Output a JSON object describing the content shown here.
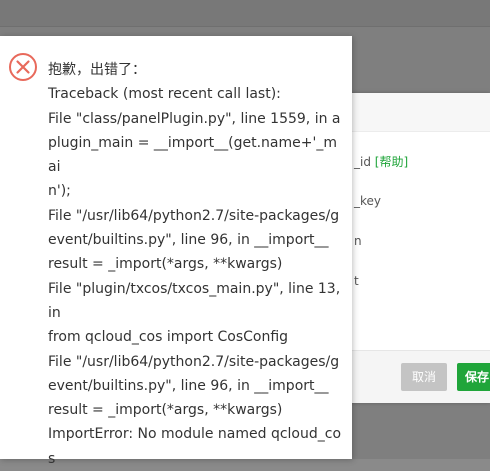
{
  "background_dialog": {
    "fields": [
      {
        "text": "_id ",
        "link": "[帮助]"
      },
      {
        "text": "_key",
        "link": ""
      },
      {
        "text": "n",
        "link": ""
      },
      {
        "text": "t",
        "link": ""
      }
    ],
    "cancel_label": "取消",
    "save_label": "保存"
  },
  "error_popup": {
    "lines": [
      "抱歉，出错了：",
      "Traceback (most recent call last):",
      "File \"class/panelPlugin.py\", line 1559, in a",
      "plugin_main = __import__(get.name+'_mai",
      "n');",
      "File \"/usr/lib64/python2.7/site-packages/g",
      "event/builtins.py\", line 96, in __import__",
      "result = _import(*args, **kwargs)",
      "File \"plugin/txcos/txcos_main.py\", line 13,",
      "in",
      "from qcloud_cos import CosConfig",
      "File \"/usr/lib64/python2.7/site-packages/g",
      "event/builtins.py\", line 96, in __import__",
      "result = _import(*args, **kwargs)",
      "ImportError: No module named qcloud_co",
      "s"
    ],
    "icon": "error-x-circle-icon",
    "icon_color": "#e8695b"
  },
  "colors": {
    "accent_green": "#20a53a",
    "overlay": "#7f7f7f"
  }
}
